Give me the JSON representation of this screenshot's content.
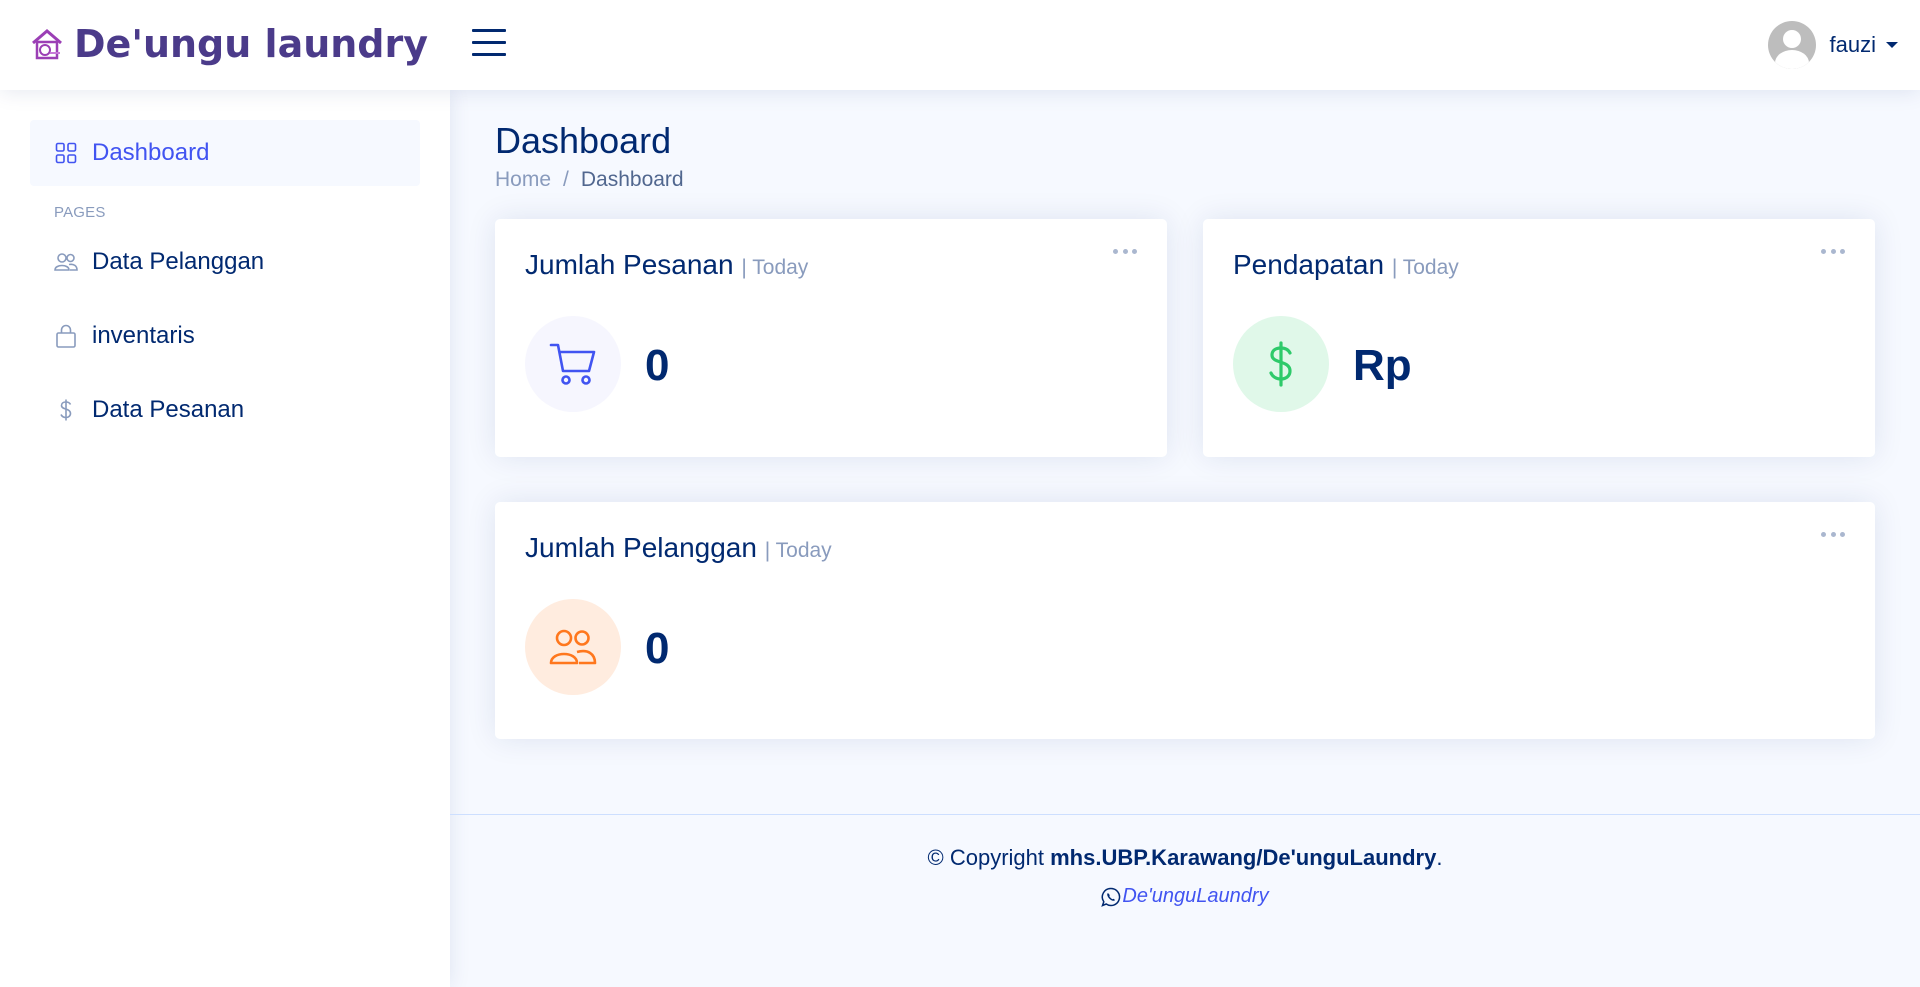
{
  "header": {
    "logo_text": "De'ungu laundry",
    "user_name": "fauzi"
  },
  "sidebar": {
    "items": [
      {
        "label": "Dashboard",
        "icon": "grid-icon"
      },
      {
        "label": "Data Pelanggan",
        "icon": "people-icon"
      },
      {
        "label": "inventaris",
        "icon": "bag-icon"
      },
      {
        "label": "Data Pesanan",
        "icon": "dollar-icon"
      }
    ],
    "heading": "PAGES"
  },
  "page": {
    "title": "Dashboard",
    "breadcrumb": [
      "Home",
      "/",
      "Dashboard"
    ]
  },
  "cards": {
    "orders": {
      "title": "Jumlah Pesanan",
      "sub": "| Today",
      "value": "0"
    },
    "revenue": {
      "title": "Pendapatan",
      "sub": "| Today",
      "value": "Rp"
    },
    "customers": {
      "title": "Jumlah Pelanggan",
      "sub": "| Today",
      "value": "0"
    }
  },
  "footer": {
    "copyright_prefix": "© Copyright ",
    "copyright_strong": "mhs.UBP.Karawang/De'unguLaundry",
    "copyright_suffix": ".",
    "credit_link": "De'unguLaundry"
  },
  "colors": {
    "primary": "#4154f1",
    "navy": "#012970",
    "brand_purple": "#4b3b8a",
    "revenue_green": "#2eca6a",
    "customer_orange": "#ff771d"
  }
}
